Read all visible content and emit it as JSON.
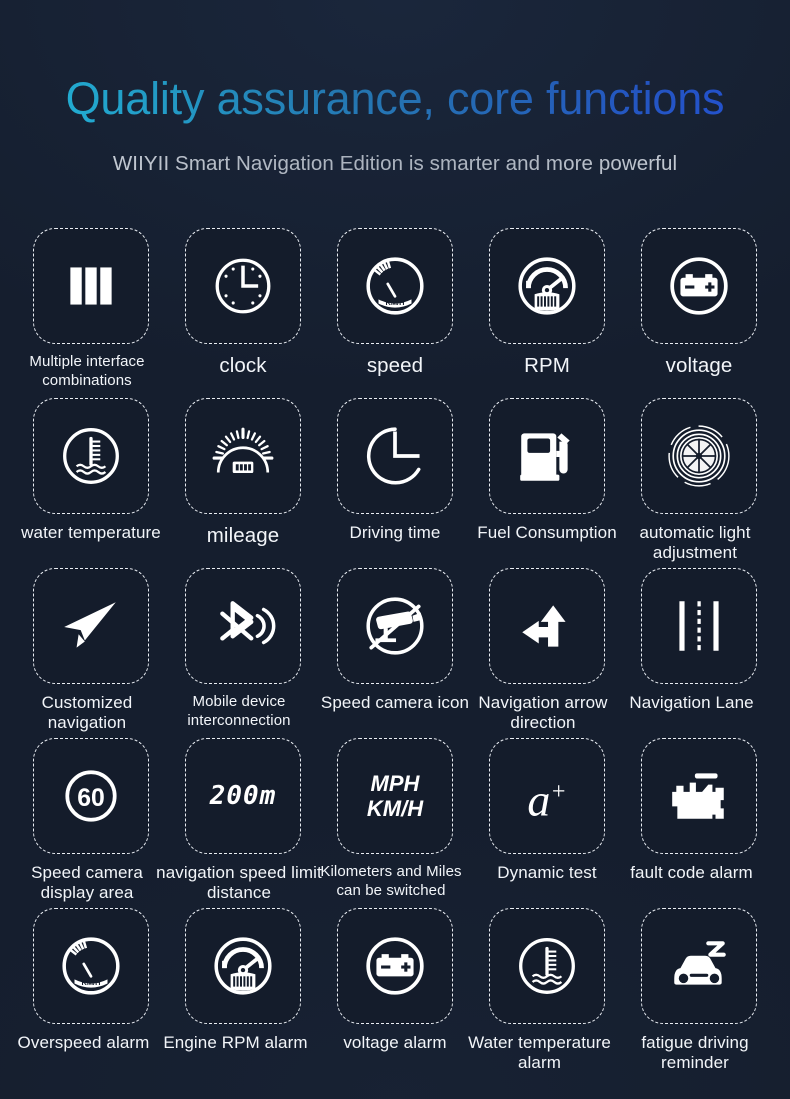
{
  "header": {
    "title": "Quality assurance, core functions",
    "subtitle": "WIIYII Smart Navigation Edition is smarter and more powerful",
    "title_gradient_from": "#22d3f7",
    "title_gradient_to": "#2355f0"
  },
  "theme": {
    "background": "#151e2e",
    "card_background": "#141c2b",
    "card_border": "#e9edf3",
    "text": "#f2f5f9",
    "icon": "#ffffff"
  },
  "features": [
    {
      "icon": "multiple-interface-bars-icon",
      "label": "Multiple interface combinations",
      "size": "sm"
    },
    {
      "icon": "clock-icon",
      "label": "clock",
      "size": "lg"
    },
    {
      "icon": "speedometer-kmh-icon",
      "label": "speed",
      "size": "lg"
    },
    {
      "icon": "rpm-gauge-icon",
      "label": "RPM",
      "size": "lg"
    },
    {
      "icon": "battery-voltage-icon",
      "label": "voltage",
      "size": "lg"
    },
    {
      "icon": "water-temperature-icon",
      "label": "water temperature",
      "size": "md"
    },
    {
      "icon": "odometer-mileage-icon",
      "label": "mileage",
      "size": "lg"
    },
    {
      "icon": "driving-time-clock-icon",
      "label": "Driving time",
      "size": "md"
    },
    {
      "icon": "fuel-pump-icon",
      "label": "Fuel Consumption",
      "size": "md"
    },
    {
      "icon": "aperture-light-sensor-icon",
      "label": "automatic light adjustment",
      "size": "md"
    },
    {
      "icon": "paper-plane-navigation-icon",
      "label": "Customized navigation",
      "size": "md"
    },
    {
      "icon": "bluetooth-signal-icon",
      "label": "Mobile device interconnection",
      "size": "sm"
    },
    {
      "icon": "speed-camera-icon",
      "label": "Speed camera icon",
      "size": "md"
    },
    {
      "icon": "navigation-arrow-direction-icon",
      "label": "Navigation arrow direction",
      "size": "md"
    },
    {
      "icon": "navigation-lane-road-icon",
      "label": "Navigation Lane",
      "size": "md"
    },
    {
      "icon": "speed-limit-60-icon",
      "label": "Speed camera display area",
      "size": "md"
    },
    {
      "icon": "distance-200m-icon",
      "label": "navigation speed limit distance",
      "size": "md"
    },
    {
      "icon": "mph-kmh-switch-icon",
      "label": "Kilometers and Miles can be switched",
      "size": "sm"
    },
    {
      "icon": "dynamic-test-a-plus-icon",
      "label": "Dynamic test",
      "size": "md"
    },
    {
      "icon": "engine-fault-code-icon",
      "label": "fault code alarm",
      "size": "md"
    },
    {
      "icon": "speedometer-kmh-icon",
      "label": "Overspeed alarm",
      "size": "md"
    },
    {
      "icon": "rpm-gauge-icon",
      "label": "Engine RPM alarm",
      "size": "md"
    },
    {
      "icon": "battery-voltage-icon",
      "label": "voltage alarm",
      "size": "md"
    },
    {
      "icon": "water-temperature-icon",
      "label": "Water temperature alarm",
      "size": "md"
    },
    {
      "icon": "fatigue-driving-car-icon",
      "label": "fatigue driving reminder",
      "size": "md"
    }
  ],
  "icon_text": {
    "speedometer_unit": "KM/H",
    "speed_limit_value": "60",
    "distance_value": "200m",
    "unit_line1": "MPH",
    "unit_line2": "KM/H",
    "dynamic_test_glyph": "a",
    "dynamic_test_sup": "+"
  }
}
